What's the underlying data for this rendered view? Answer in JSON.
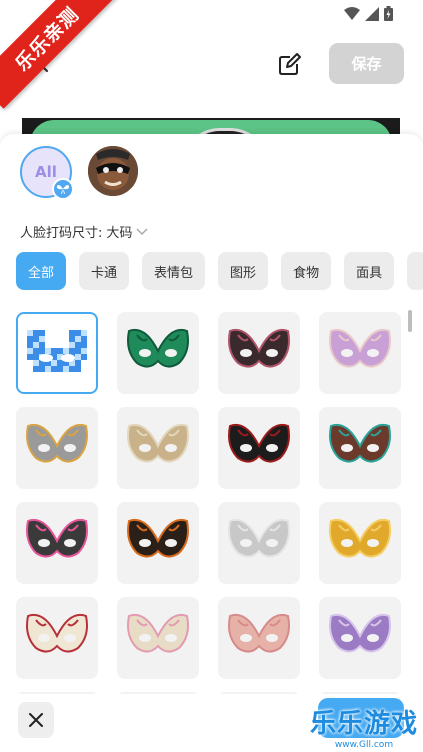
{
  "ribbon": {
    "text": "乐乐亲测"
  },
  "toolbar": {
    "save_label": "保存"
  },
  "face_panel": {
    "all_label": "All"
  },
  "size_selector": {
    "label": "人脸打码尺寸:",
    "value": "大码"
  },
  "categories": [
    {
      "label": "全部",
      "active": true
    },
    {
      "label": "卡通"
    },
    {
      "label": "表情包"
    },
    {
      "label": "图形"
    },
    {
      "label": "食物"
    },
    {
      "label": "面具"
    }
  ],
  "masks": [
    {
      "icon": "pixel-mask-icon",
      "colors": [
        "#3b8de8",
        "#bfe0ff"
      ],
      "selected": true
    },
    {
      "icon": "green-butterfly-mask-icon",
      "colors": [
        "#1f8a5a",
        "#0e5a3a"
      ]
    },
    {
      "icon": "dark-butterfly-mask-icon",
      "colors": [
        "#3a2a2e",
        "#b0546a"
      ]
    },
    {
      "icon": "lilac-butterfly-mask-icon",
      "colors": [
        "#c9a0d6",
        "#e8c8c8"
      ]
    },
    {
      "icon": "silver-gold-mask-icon",
      "colors": [
        "#9a9a9a",
        "#d9a441"
      ]
    },
    {
      "icon": "leaf-mask-icon",
      "colors": [
        "#c9b28a",
        "#e2d6bc"
      ]
    },
    {
      "icon": "rose-lace-mask-icon",
      "colors": [
        "#1c1c1c",
        "#9b1b1b"
      ]
    },
    {
      "icon": "jeweled-mask-icon",
      "colors": [
        "#6b3a2a",
        "#2aa39a"
      ]
    },
    {
      "icon": "pink-flower-mask-icon",
      "colors": [
        "#3a3a3a",
        "#e8549a"
      ]
    },
    {
      "icon": "autumn-mask-icon",
      "colors": [
        "#2a2018",
        "#d86a1e"
      ]
    },
    {
      "icon": "silver-mask-icon",
      "colors": [
        "#c8c8c8",
        "#e4e4e4"
      ]
    },
    {
      "icon": "gold-mask-icon",
      "colors": [
        "#e0a92c",
        "#f4cd62"
      ]
    },
    {
      "icon": "red-rose-mask-icon",
      "colors": [
        "#f0e6d4",
        "#b8303a"
      ]
    },
    {
      "icon": "pink-lily-mask-icon",
      "colors": [
        "#e8dcc6",
        "#e29bb0"
      ]
    },
    {
      "icon": "rose-gold-mask-icon",
      "colors": [
        "#e6b2a8",
        "#d68a8a"
      ]
    },
    {
      "icon": "purple-lace-mask-icon",
      "colors": [
        "#9b7cc4",
        "#d6c4ea"
      ]
    }
  ],
  "watermark": {
    "title": "乐乐游戏",
    "url": "www.Gll.com"
  }
}
